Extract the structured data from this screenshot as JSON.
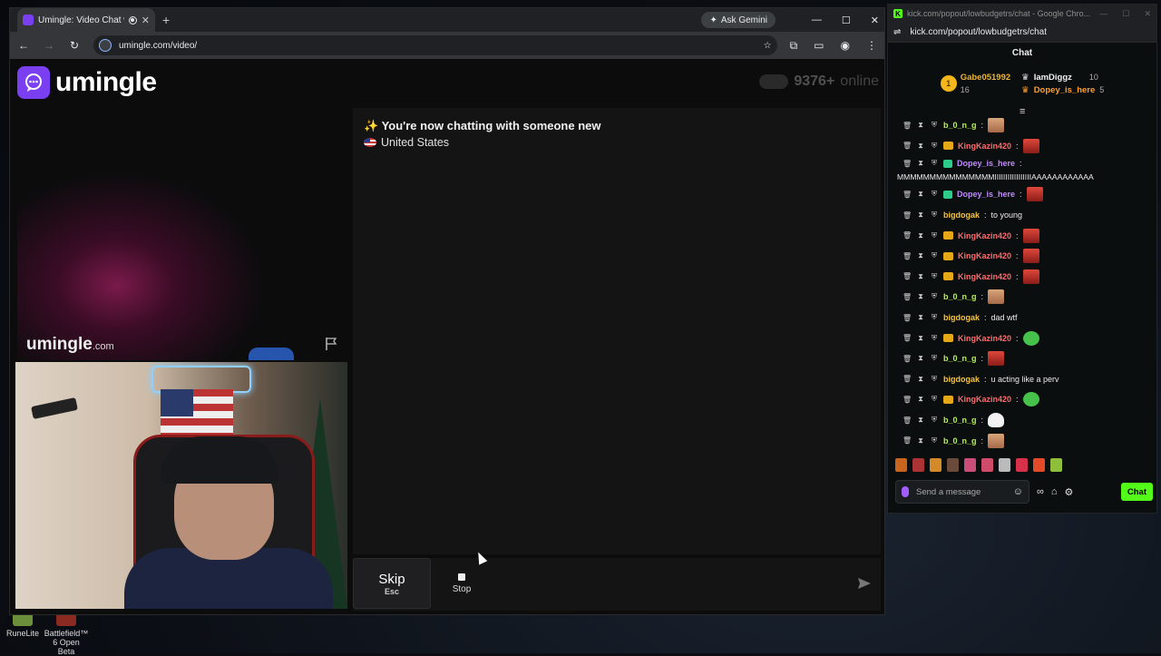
{
  "desktop": {
    "icons": [
      {
        "label": "RuneLite"
      },
      {
        "label": "Battlefield™ 6 Open Beta"
      }
    ]
  },
  "browser": {
    "tab_title": "Umingle: Video Chat with St",
    "ask_gemini": "Ask Gemini",
    "url": "umingle.com/video/"
  },
  "umingle": {
    "logo": "umingle",
    "online_count": "9376+",
    "online_label": "online",
    "watermark": "umingle",
    "watermark_suffix": ".com",
    "notice": "✨ You're now chatting with someone new",
    "country": "United States",
    "skip_label": "Skip",
    "skip_key": "Esc",
    "stop_label": "Stop"
  },
  "kick": {
    "window_title": "kick.com/popout/lowbudgetrs/chat - Google Chro...",
    "url": "kick.com/popout/lowbudgetrs/chat",
    "header": "Chat",
    "leader1": {
      "rank": "1",
      "name": "Gabe051992",
      "count": "16"
    },
    "leader2": {
      "name": "IamDiggz",
      "count": "10"
    },
    "leader3": {
      "name": "Dopey_is_here",
      "count": "5"
    },
    "messages": [
      {
        "user": "b_0_n_g",
        "text": ""
      },
      {
        "user": "KingKazin420",
        "text": ""
      },
      {
        "user": "Dopey_is_here",
        "text": "MMMMMMMMMMMMMMMIIIIIIIIIIIIIIIIIAAAAAAAAAAAA"
      },
      {
        "user": "Dopey_is_here",
        "text": ""
      },
      {
        "user": "bigdogak",
        "text": "to young"
      },
      {
        "user": "KingKazin420",
        "text": ""
      },
      {
        "user": "KingKazin420",
        "text": ""
      },
      {
        "user": "KingKazin420",
        "text": ""
      },
      {
        "user": "b_0_n_g",
        "text": ""
      },
      {
        "user": "bigdogak",
        "text": "dad wtf"
      },
      {
        "user": "KingKazin420",
        "text": ""
      },
      {
        "user": "b_0_n_g",
        "text": ""
      },
      {
        "user": "bigdogak",
        "text": "u acting like a perv"
      },
      {
        "user": "KingKazin420",
        "text": ""
      },
      {
        "user": "b_0_n_g",
        "text": ""
      },
      {
        "user": "b_0_n_g",
        "text": ""
      }
    ],
    "input_placeholder": "Send a message",
    "chat_button": "Chat"
  }
}
